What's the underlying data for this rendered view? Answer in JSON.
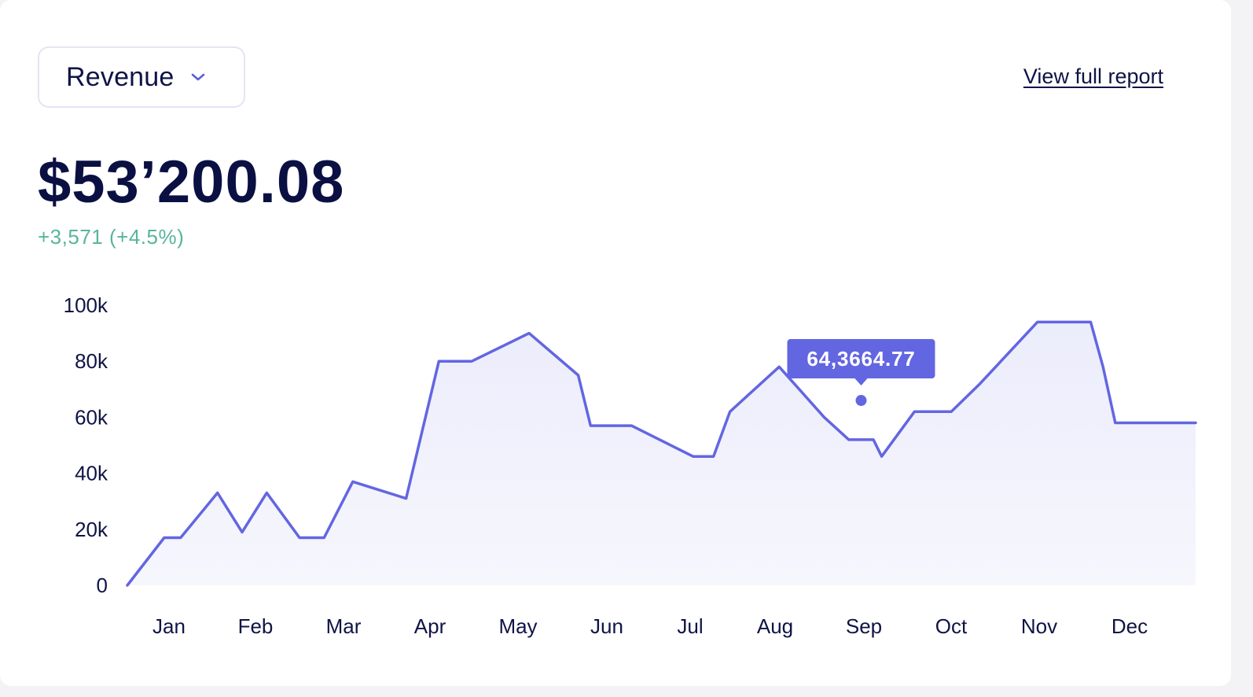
{
  "header": {
    "dropdown_label": "Revenue",
    "report_link": "View full report"
  },
  "summary": {
    "amount": "$53’200.08",
    "delta": "+3,571 (+4.5%)"
  },
  "colors": {
    "line": "#6366e1",
    "area_top": "#ecedfb",
    "text": "#0f1445",
    "positive": "#58b59c"
  },
  "tooltip": {
    "text": "64,3664.77",
    "x": 8.95,
    "y": 66
  },
  "chart_data": {
    "type": "area",
    "title": "",
    "xlabel": "",
    "ylabel": "",
    "categories": [
      "Jan",
      "Feb",
      "Mar",
      "Apr",
      "May",
      "Jun",
      "Jul",
      "Aug",
      "Sep",
      "Oct",
      "Nov",
      "Dec"
    ],
    "ylim": [
      0,
      100000
    ],
    "yticks": [
      0,
      20000,
      40000,
      60000,
      80000,
      100000
    ],
    "ytick_labels": [
      "0",
      "20k",
      "40k",
      "60k",
      "80k",
      "100k"
    ],
    "grid": false,
    "series": [
      {
        "x": [
          0,
          0.45,
          0.65,
          1.1,
          1.4,
          1.7,
          2.1,
          2.4,
          2.75,
          3.4,
          3.8,
          4.2,
          4.9,
          5.5,
          5.65,
          6.15,
          6.9,
          7.15,
          7.35,
          7.95,
          8.5,
          8.8,
          9.1,
          9.2,
          9.6,
          10.05,
          10.4,
          11.1,
          11.75,
          11.9,
          12.05,
          13.05
        ],
        "y": [
          0,
          17000,
          17000,
          33000,
          19000,
          33000,
          17000,
          17000,
          37000,
          31000,
          80000,
          80000,
          90000,
          75000,
          57000,
          57000,
          46000,
          46000,
          62000,
          78000,
          60000,
          52000,
          52000,
          46000,
          62000,
          62000,
          72000,
          94000,
          94000,
          78000,
          58000,
          58000
        ]
      }
    ]
  }
}
